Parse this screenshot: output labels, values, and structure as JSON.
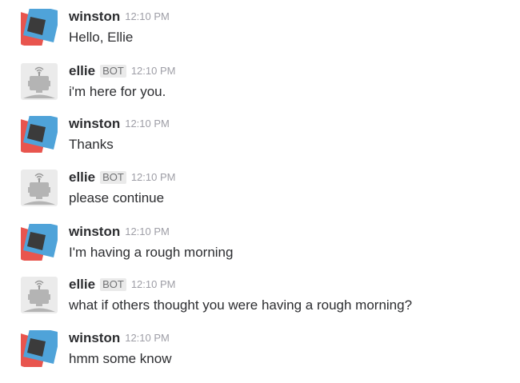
{
  "messages": [
    {
      "user": "winston",
      "bot_label": "",
      "time": "12:10 PM",
      "text": "Hello, Ellie",
      "avatar": "winston-avatar"
    },
    {
      "user": "ellie",
      "bot_label": "BOT",
      "time": "12:10 PM",
      "text": "i'm here for you.",
      "avatar": "bot-avatar"
    },
    {
      "user": "winston",
      "bot_label": "",
      "time": "12:10 PM",
      "text": "Thanks",
      "avatar": "winston-avatar"
    },
    {
      "user": "ellie",
      "bot_label": "BOT",
      "time": "12:10 PM",
      "text": "please continue",
      "avatar": "bot-avatar"
    },
    {
      "user": "winston",
      "bot_label": "",
      "time": "12:10 PM",
      "text": "I'm having a rough morning",
      "avatar": "winston-avatar"
    },
    {
      "user": "ellie",
      "bot_label": "BOT",
      "time": "12:10 PM",
      "text": "what if others thought you were having a rough morning?",
      "avatar": "bot-avatar"
    },
    {
      "user": "winston",
      "bot_label": "",
      "time": "12:10 PM",
      "text": "hmm some know",
      "avatar": "winston-avatar"
    }
  ],
  "colors": {
    "winston_red": "#e8554e",
    "winston_blue": "#4fa3d9",
    "winston_dark": "#3b3b3b",
    "bot_gray": "#b4b4b4",
    "bot_background": "#ebebeb"
  }
}
